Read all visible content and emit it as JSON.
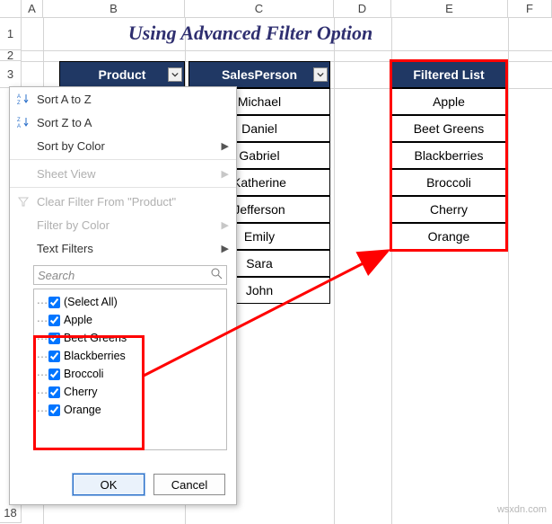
{
  "title": "Using Advanced Filter Option",
  "columns": {
    "A": 24,
    "B": 158,
    "C": 166,
    "D": 64,
    "E": 130,
    "F": 49
  },
  "col_labels": [
    "A",
    "B",
    "C",
    "D",
    "E",
    "F"
  ],
  "row_labels_top": [
    "1",
    "2",
    "3"
  ],
  "row_label_bottom": "18",
  "headers": {
    "product": "Product",
    "salesperson": "SalesPerson",
    "filtered": "Filtered List"
  },
  "salespersons": [
    "Michael",
    "Daniel",
    "Gabriel",
    "Katherine",
    "Jefferson",
    "Emily",
    "Sara",
    "John"
  ],
  "filtered_list": [
    "Apple",
    "Beet Greens",
    "Blackberries",
    "Broccoli",
    "Cherry",
    "Orange"
  ],
  "menu": {
    "sort_az": "Sort A to Z",
    "sort_za": "Sort Z to A",
    "sort_color": "Sort by Color",
    "sheet_view": "Sheet View",
    "clear_filter": "Clear Filter From \"Product\"",
    "filter_color": "Filter by Color",
    "text_filters": "Text Filters",
    "search_placeholder": "Search",
    "items": [
      "(Select All)",
      "Apple",
      "Beet Greens",
      "Blackberries",
      "Broccoli",
      "Cherry",
      "Orange"
    ],
    "ok": "OK",
    "cancel": "Cancel"
  },
  "watermark": "wsxdn.com"
}
